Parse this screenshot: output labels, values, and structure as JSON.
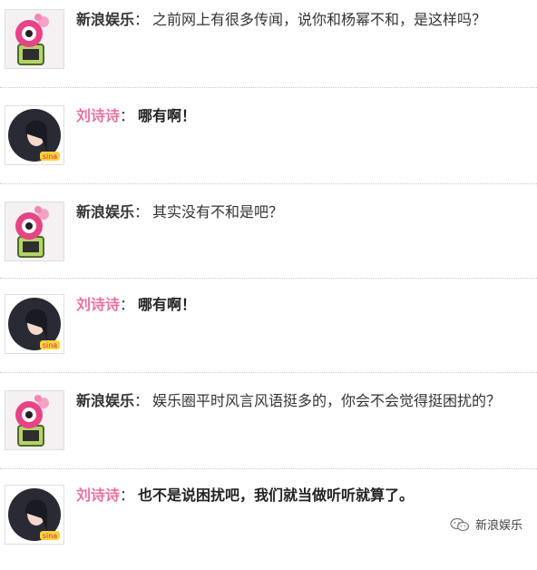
{
  "messages": [
    {
      "speaker": "新浪娱乐",
      "role": "sina",
      "text": "之前网上有很多传闻，说你和杨幂不和，是这样吗？"
    },
    {
      "speaker": "刘诗诗",
      "role": "liu",
      "text": "哪有啊！"
    },
    {
      "speaker": "新浪娱乐",
      "role": "sina",
      "text": "其实没有不和是吧？"
    },
    {
      "speaker": "刘诗诗",
      "role": "liu",
      "text": "哪有啊！"
    },
    {
      "speaker": "新浪娱乐",
      "role": "sina",
      "text": "娱乐圈平时风言风语挺多的，你会不会觉得挺困扰的？"
    },
    {
      "speaker": "刘诗诗",
      "role": "liu",
      "text": "也不是说困扰吧，我们就当做听听就算了。"
    }
  ],
  "colon": "：",
  "avatar_badge": "sina",
  "watermark": {
    "label": "新浪娱乐",
    "icon": "wechat-icon"
  },
  "colors": {
    "liu_name": "#e872a2",
    "divider": "#c9c9c9"
  }
}
